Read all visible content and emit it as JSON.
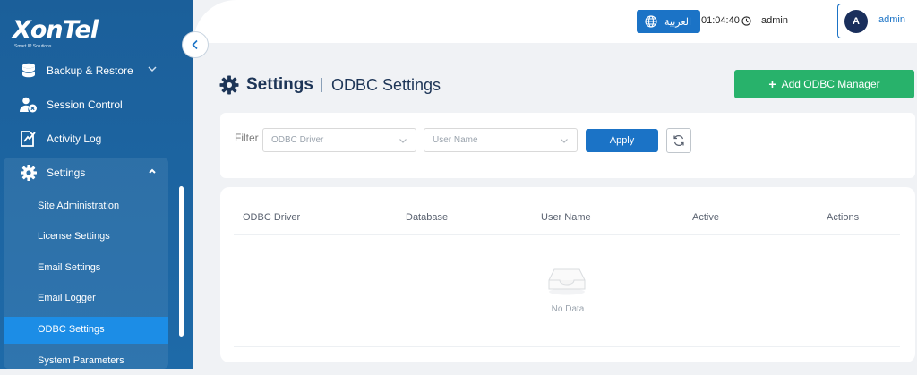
{
  "brand": {
    "name": "XonTel",
    "tagline": "Smart IP Solutions"
  },
  "sidebar": {
    "items": [
      {
        "label": "Backup & Restore",
        "icon": "database-icon"
      },
      {
        "label": "Session Control",
        "icon": "user-session-icon"
      },
      {
        "label": "Activity Log",
        "icon": "activity-log-icon"
      },
      {
        "label": "Settings",
        "icon": "gear-icon"
      }
    ],
    "submenu": [
      {
        "label": "Site Administration"
      },
      {
        "label": "License Settings"
      },
      {
        "label": "Email Settings"
      },
      {
        "label": "Email Logger"
      },
      {
        "label": "ODBC Settings",
        "active": true
      },
      {
        "label": "System Parameters"
      }
    ]
  },
  "header": {
    "language_label": "العربية",
    "time": "01:04:40",
    "username": "admin",
    "avatar_initial": "A",
    "user_card_name": "admin"
  },
  "page": {
    "title": "Settings",
    "subtitle": "ODBC Settings",
    "add_button_label": "Add ODBC Manager"
  },
  "filter": {
    "label": "Filter",
    "driver_placeholder": "ODBC Driver",
    "username_placeholder": "User Name",
    "apply_label": "Apply"
  },
  "table": {
    "columns": [
      "ODBC Driver",
      "Database",
      "User Name",
      "Active",
      "Actions"
    ],
    "rows": [],
    "empty_text": "No Data"
  },
  "colors": {
    "sidebar": "#1b5f9a",
    "primary": "#1b73c6",
    "active_item": "#1c8de6",
    "success": "#28b26b",
    "title": "#1d3557"
  }
}
